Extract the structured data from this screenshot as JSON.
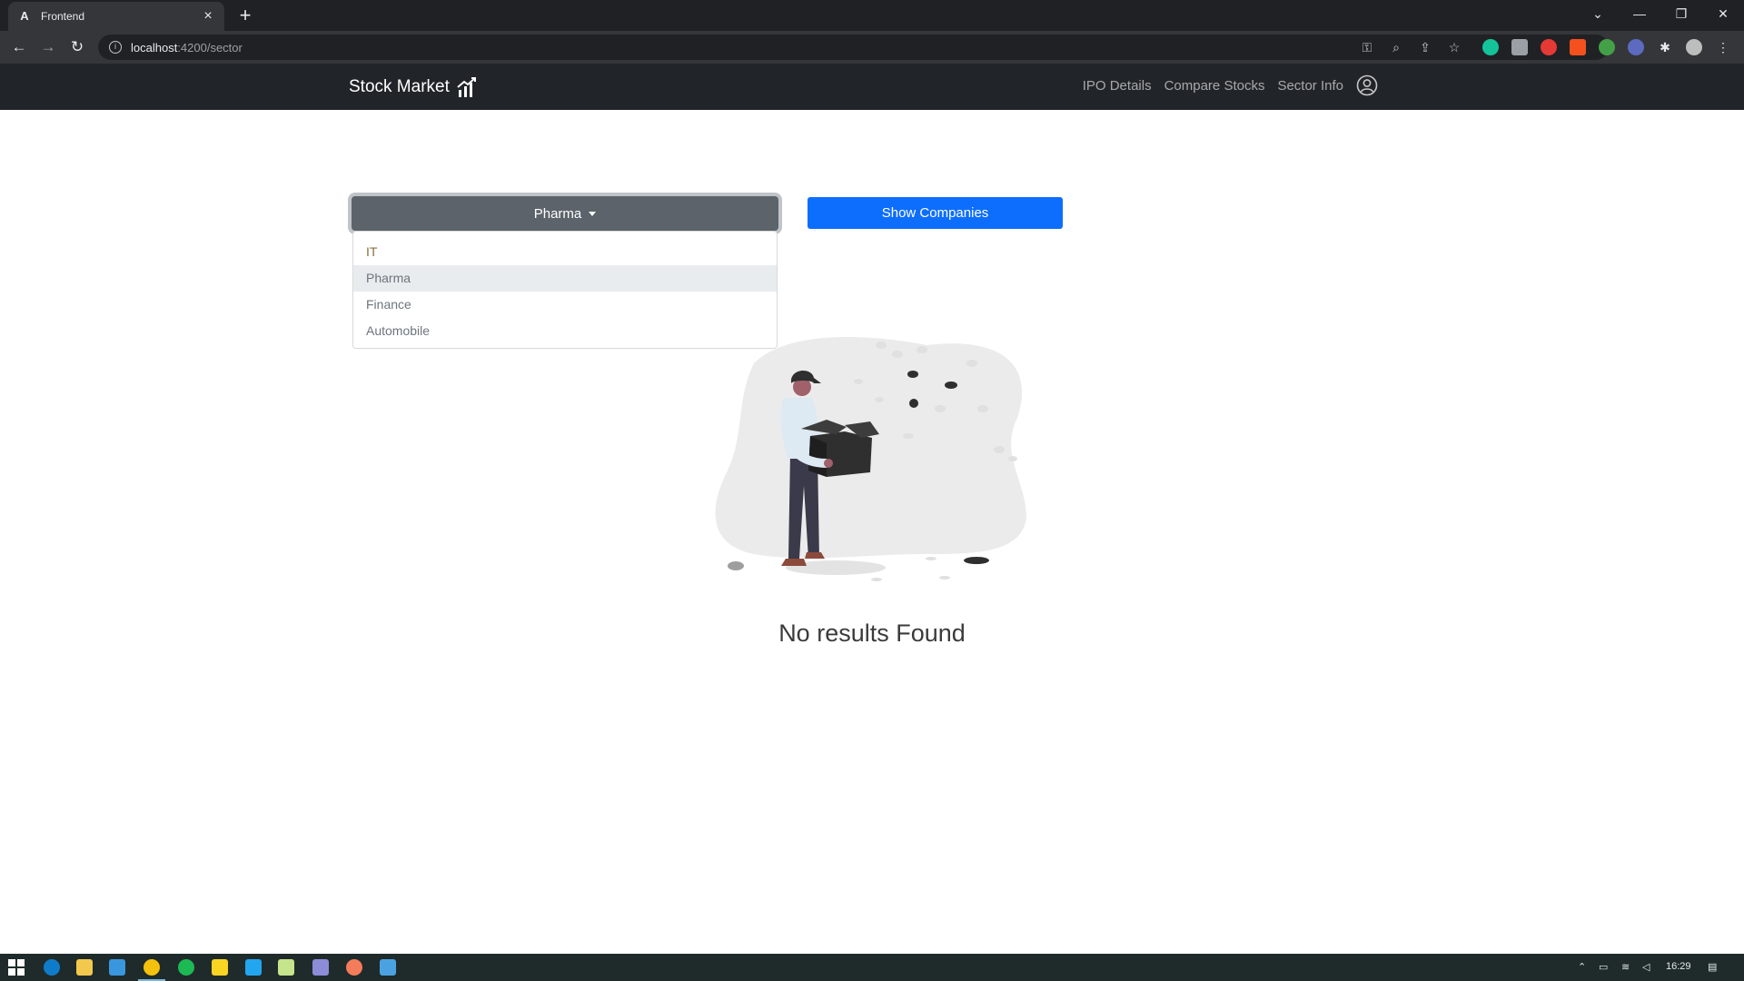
{
  "browser": {
    "tab_title": "Frontend",
    "tab_favicon": "A",
    "url_host": "localhost",
    "url_path": ":4200/sector"
  },
  "navbar": {
    "brand": "Stock Market",
    "links": [
      "IPO Details",
      "Compare Stocks",
      "Sector Info"
    ]
  },
  "sector_dropdown": {
    "selected": "Pharma",
    "options": [
      "IT",
      "Pharma",
      "Finance",
      "Automobile"
    ]
  },
  "show_button_label": "Show Companies",
  "empty_message": "No results Found",
  "taskbar": {
    "clock": "16:29"
  },
  "colors": {
    "navbar_bg": "#212529",
    "primary": "#0d6efd",
    "dropdown_btn": "#5c636a"
  }
}
